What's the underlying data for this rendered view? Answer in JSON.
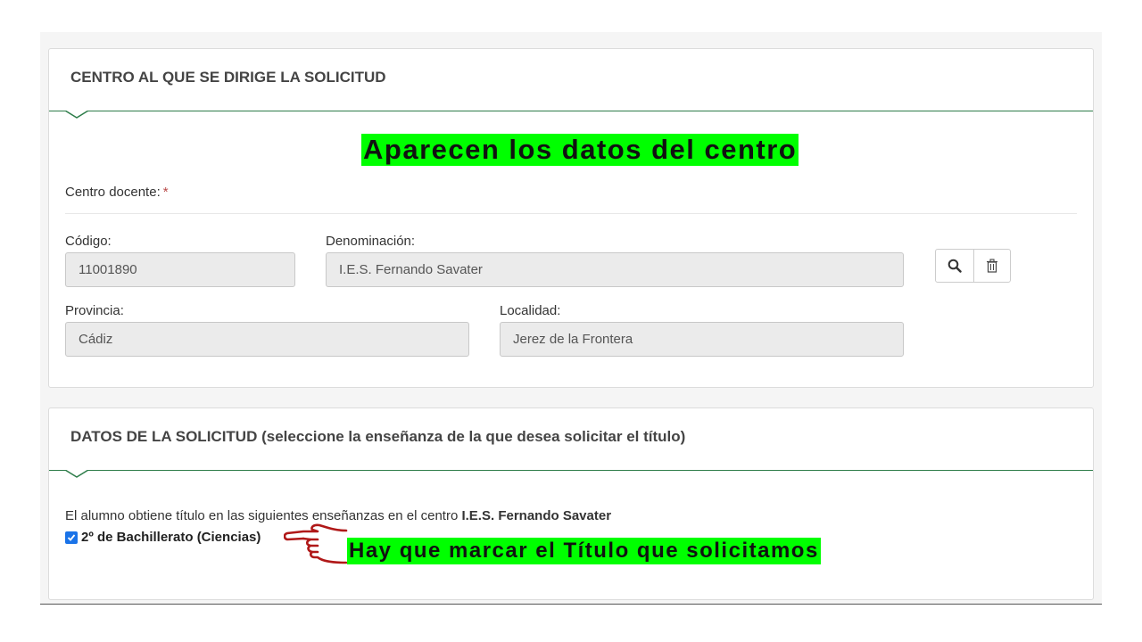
{
  "panel1": {
    "title": "CENTRO AL QUE SE DIRIGE LA SOLICITUD",
    "centro_label": "Centro docente:",
    "required_mark": "*",
    "codigo_label": "Código:",
    "codigo_value": "11001890",
    "denominacion_label": "Denominación:",
    "denominacion_value": "I.E.S. Fernando Savater",
    "provincia_label": "Provincia:",
    "provincia_value": "Cádiz",
    "localidad_label": "Localidad:",
    "localidad_value": "Jerez de la Frontera",
    "search_icon": "search-icon",
    "delete_icon": "trash-icon"
  },
  "panel2": {
    "title_bold": "DATOS DE LA SOLICITUD",
    "title_rest": "(seleccione la enseñanza de la que desea solicitar el título)",
    "info_text": "El alumno obtiene título en las siguientes enseñanzas en el centro",
    "info_centro": "I.E.S. Fernando Savater",
    "option_label": "2º de Bachillerato (Ciencias)",
    "option_checked": true
  },
  "annotations": {
    "banner1": "Aparecen los datos del centro",
    "banner2": "Hay que marcar el Título que solicitamos",
    "highlight_color": "#00ff00",
    "hand_color": "#b01818"
  },
  "colors": {
    "accent_green": "#2e7d4a",
    "checkbox_blue": "#1a73e8"
  }
}
